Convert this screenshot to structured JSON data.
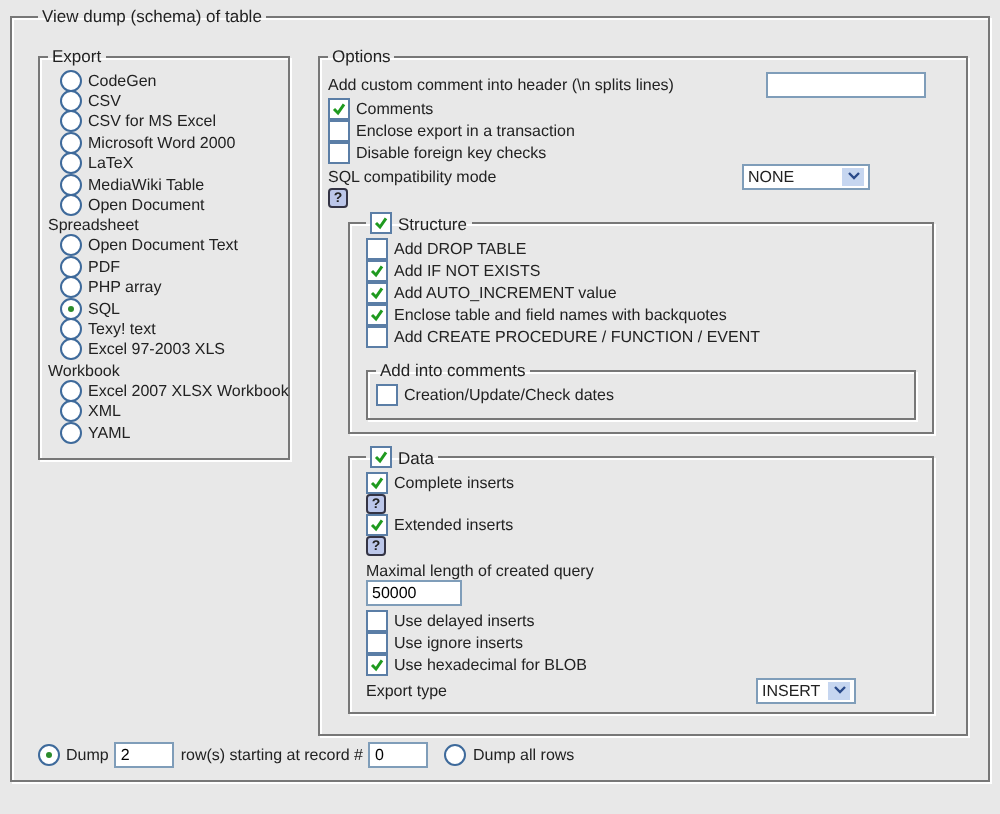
{
  "title": "View dump (schema) of table",
  "export": {
    "legend": "Export",
    "groups": [
      {
        "formats": [
          {
            "label": "CodeGen",
            "selected": false
          },
          {
            "label": "CSV",
            "selected": false
          },
          {
            "label": "CSV for MS Excel",
            "selected": false
          },
          {
            "label": "Microsoft Word 2000",
            "selected": false
          },
          {
            "label": "LaTeX",
            "selected": false
          },
          {
            "label": "MediaWiki Table",
            "selected": false
          },
          {
            "label": "Open Document",
            "selected": false
          }
        ]
      },
      {
        "heading": "Spreadsheet",
        "formats": [
          {
            "label": "Open Document Text",
            "selected": false
          },
          {
            "label": "PDF",
            "selected": false
          },
          {
            "label": "PHP array",
            "selected": false
          },
          {
            "label": "SQL",
            "selected": true
          },
          {
            "label": "Texy! text",
            "selected": false
          },
          {
            "label": "Excel 97-2003 XLS",
            "selected": false
          }
        ]
      },
      {
        "heading": "Workbook",
        "formats": [
          {
            "label": "Excel 2007 XLSX Workbook",
            "selected": false
          },
          {
            "label": "XML",
            "selected": false
          },
          {
            "label": "YAML",
            "selected": false
          }
        ]
      }
    ]
  },
  "options": {
    "legend": "Options",
    "comment_label": "Add custom comment into header (\\n splits lines)",
    "checks": [
      {
        "label": "Comments",
        "checked": true
      },
      {
        "label": "Enclose export in a transaction",
        "checked": false
      },
      {
        "label": "Disable foreign key checks",
        "checked": false
      }
    ],
    "compat_label": "SQL compatibility mode",
    "compat_value": "NONE",
    "help": "?",
    "structure": {
      "legend": "Structure",
      "checked": true,
      "options": [
        {
          "label": "Add DROP TABLE",
          "checked": false
        },
        {
          "label": "Add IF NOT EXISTS",
          "checked": true
        },
        {
          "label": "Add AUTO_INCREMENT value",
          "checked": true
        },
        {
          "label": "Enclose table and field names with backquotes",
          "checked": true
        },
        {
          "label": "Add CREATE PROCEDURE / FUNCTION / EVENT",
          "checked": false
        }
      ],
      "comments": {
        "legend": "Add into comments",
        "options": [
          {
            "label": "Creation/Update/Check dates",
            "checked": false
          }
        ]
      }
    },
    "data": {
      "legend": "Data",
      "checked": true,
      "items": [
        {
          "kind": "checkbox",
          "label": "Complete inserts",
          "checked": true
        },
        {
          "kind": "help",
          "text": "?"
        },
        {
          "kind": "checkbox",
          "label": "Extended inserts",
          "checked": true
        },
        {
          "kind": "help",
          "text": "?"
        },
        {
          "kind": "field",
          "label": "Maximal length of created query",
          "value": "50000"
        },
        {
          "kind": "checkbox",
          "label": "Use delayed inserts",
          "checked": false
        },
        {
          "kind": "checkbox",
          "label": "Use ignore inserts",
          "checked": false
        },
        {
          "kind": "checkbox",
          "label": "Use hexadecimal for BLOB",
          "checked": true
        },
        {
          "kind": "select",
          "label": "Export type",
          "value": "INSERT"
        }
      ]
    }
  },
  "footer": {
    "dump": {
      "label": "Dump",
      "selected": true,
      "count": "2",
      "middle": "row(s) starting at record #",
      "start": "0"
    },
    "all": {
      "label": "Dump all rows",
      "selected": false
    }
  }
}
